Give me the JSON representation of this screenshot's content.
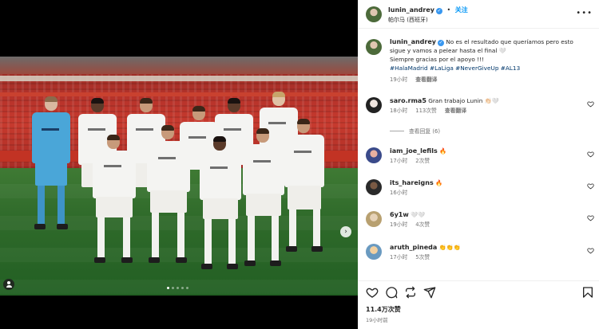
{
  "header": {
    "username": "lunin_andrey",
    "separator": "•",
    "follow_label": "关注",
    "location": "帕尔马 (西班牙)",
    "more_icon": "more-horizontal-icon"
  },
  "caption": {
    "username": "lunin_andrey",
    "text_line1": "No es el resultado que queríamos pero esto sigue y vamos a pelear hasta el final 🤍",
    "text_line2": "Siempre gracias por el apoyo !!!",
    "hashtags": "#HalaMadrid #LaLiga #NeverGiveUp #AL13",
    "time": "19小时",
    "translate": "查看翻译"
  },
  "comments": [
    {
      "username": "saro.rma5",
      "text": "Gran trabajo Lunin 👏🏻🤍",
      "time": "18小时",
      "likes": "113次赞",
      "action": "查看翻译",
      "replies": "查看回复 (6)"
    },
    {
      "username": "iam_joe_lefils",
      "text": "🔥",
      "time": "17小时",
      "likes": "2次赞"
    },
    {
      "username": "its_hareigns",
      "text": "🔥",
      "time": "16小时"
    },
    {
      "username": "6y1w",
      "text": "🤍🤍",
      "time": "19小时",
      "likes": "4次赞"
    },
    {
      "username": "aruth_pineda",
      "text": "👏👏👏",
      "time": "17小时",
      "likes": "5次赞"
    }
  ],
  "footer": {
    "likes": "11.4万次赞",
    "time_ago": "19小时前"
  },
  "colors": {
    "accent": "#0095f6",
    "verified": "#3897f0",
    "muted": "#737373",
    "hashtag": "#00376b"
  },
  "carousel": {
    "total": 5,
    "active": 1
  }
}
